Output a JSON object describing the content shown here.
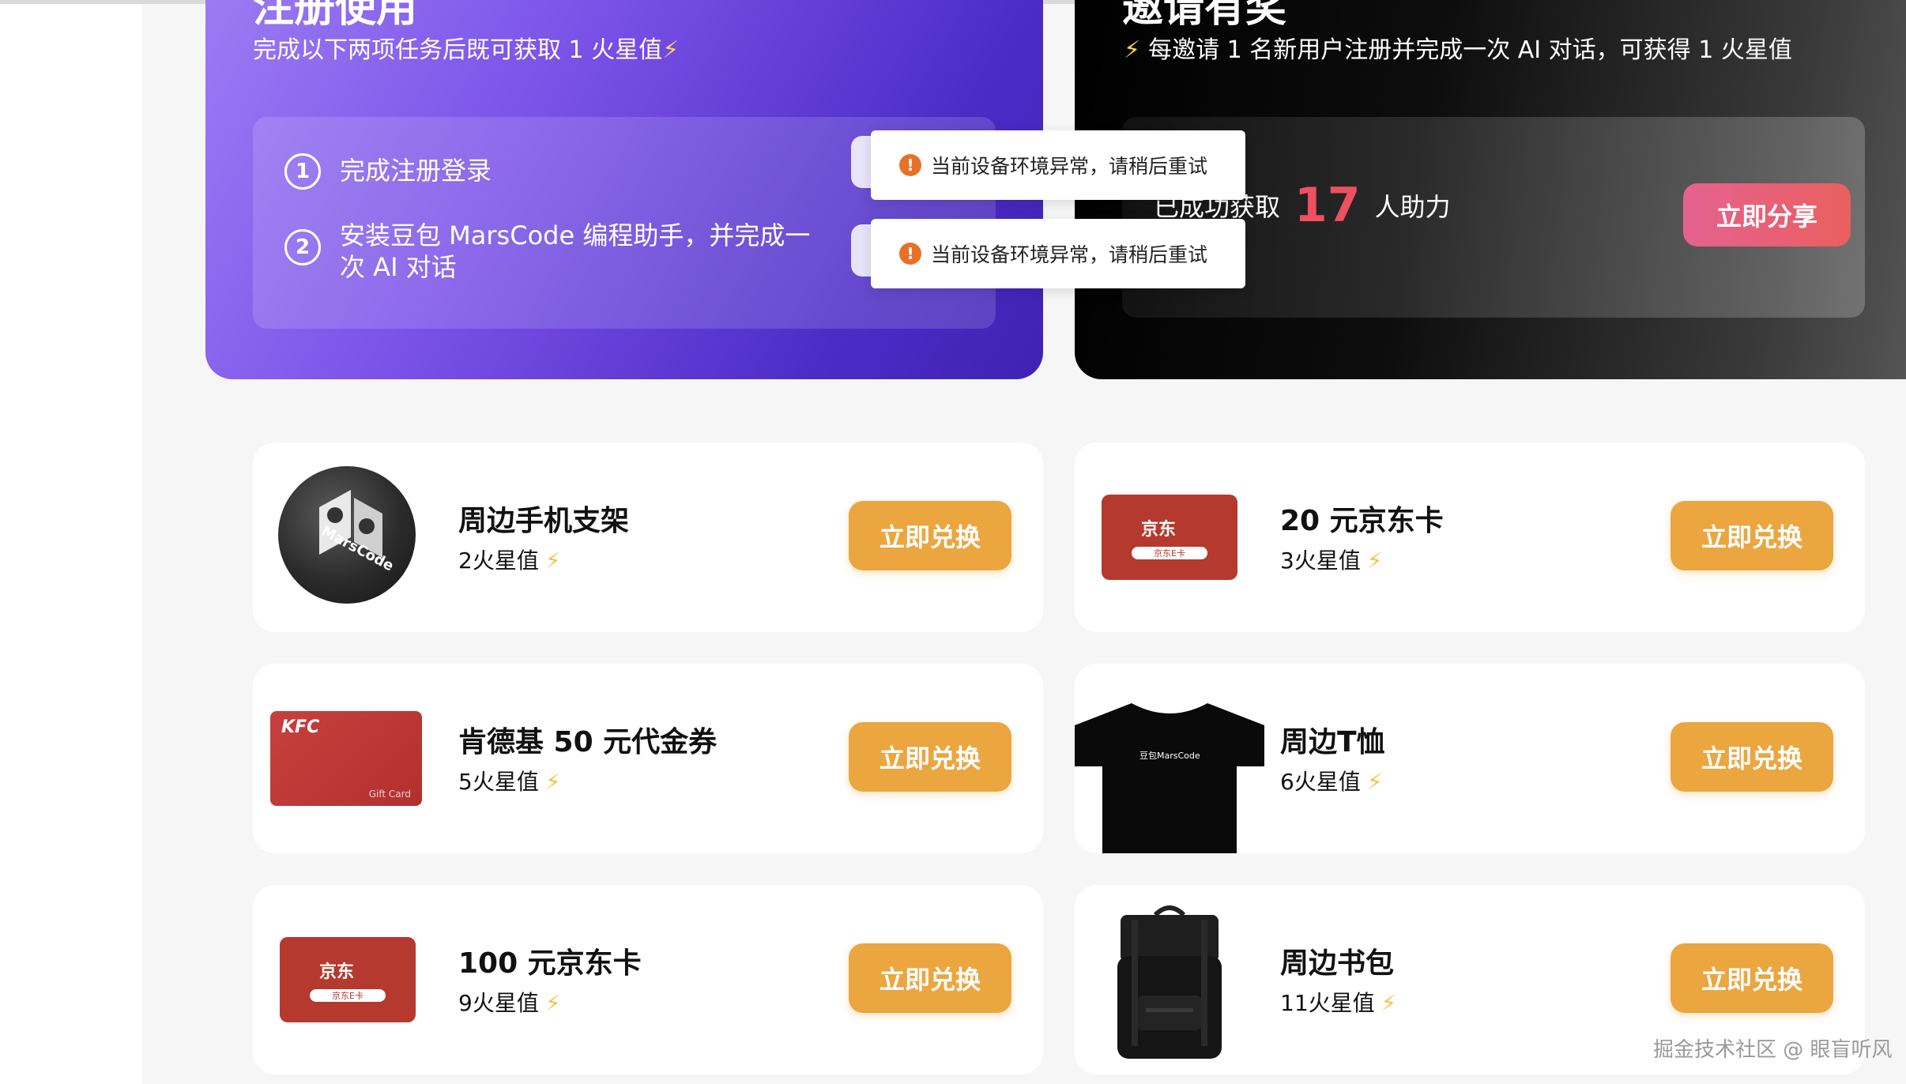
{
  "register": {
    "title": "注册使用",
    "subtitle": "完成以下两项任务后既可获取 1 火星值",
    "subtitle_icon": "⚡",
    "tasks": [
      {
        "num": "1",
        "text": "完成注册登录"
      },
      {
        "num": "2",
        "text": "安装豆包 MarsCode 编程助手，并完成一次 AI 对话"
      }
    ]
  },
  "invite": {
    "title": "邀请有奖",
    "subtitle_icon": "⚡",
    "subtitle": "每邀请 1 名新用户注册并完成一次 AI 对话，可获得 1 火星值",
    "prefix": "已成功获取",
    "count": "17",
    "suffix": "人助力",
    "share_button": "立即分享"
  },
  "toasts": [
    {
      "icon": "!",
      "message": "当前设备环境异常，请稍后重试"
    },
    {
      "icon": "!",
      "message": "当前设备环境异常，请稍后重试"
    }
  ],
  "rewards": [
    {
      "name": "周边手机支架",
      "cost": "2火星值",
      "button": "立即兑换",
      "image": "marscode-phone-stand"
    },
    {
      "name": "20 元京东卡",
      "cost": "3火星值",
      "button": "立即兑换",
      "image": "jd-card"
    },
    {
      "name": "肯德基 50 元代金券",
      "cost": "5火星值",
      "button": "立即兑换",
      "image": "kfc-gift-card"
    },
    {
      "name": "周边T恤",
      "cost": "6火星值",
      "button": "立即兑换",
      "image": "marscode-tshirt"
    },
    {
      "name": "100 元京东卡",
      "cost": "9火星值",
      "button": "立即兑换",
      "image": "jd-card"
    },
    {
      "name": "周边书包",
      "cost": "11火星值",
      "button": "立即兑换",
      "image": "marscode-backpack"
    }
  ],
  "images": {
    "mc_logo_text": "MarsCode",
    "jd_logo": "京东",
    "jd_bar": "京东E卡",
    "kfc_logo": "KFC",
    "kfc_gift": "Gift Card",
    "tshirt_logo": "豆包MarsCode"
  },
  "bolt": "⚡",
  "watermark": "掘金技术社区 @ 眼盲听风",
  "colors": {
    "register_gradient_start": "#9c7cf4",
    "register_gradient_end": "#3f22b3",
    "invite_bg": "#000000",
    "share_button": "#e46290",
    "redeem_button": "#eba63f",
    "count_color": "#ee5060",
    "toast_icon": "#e87128"
  }
}
